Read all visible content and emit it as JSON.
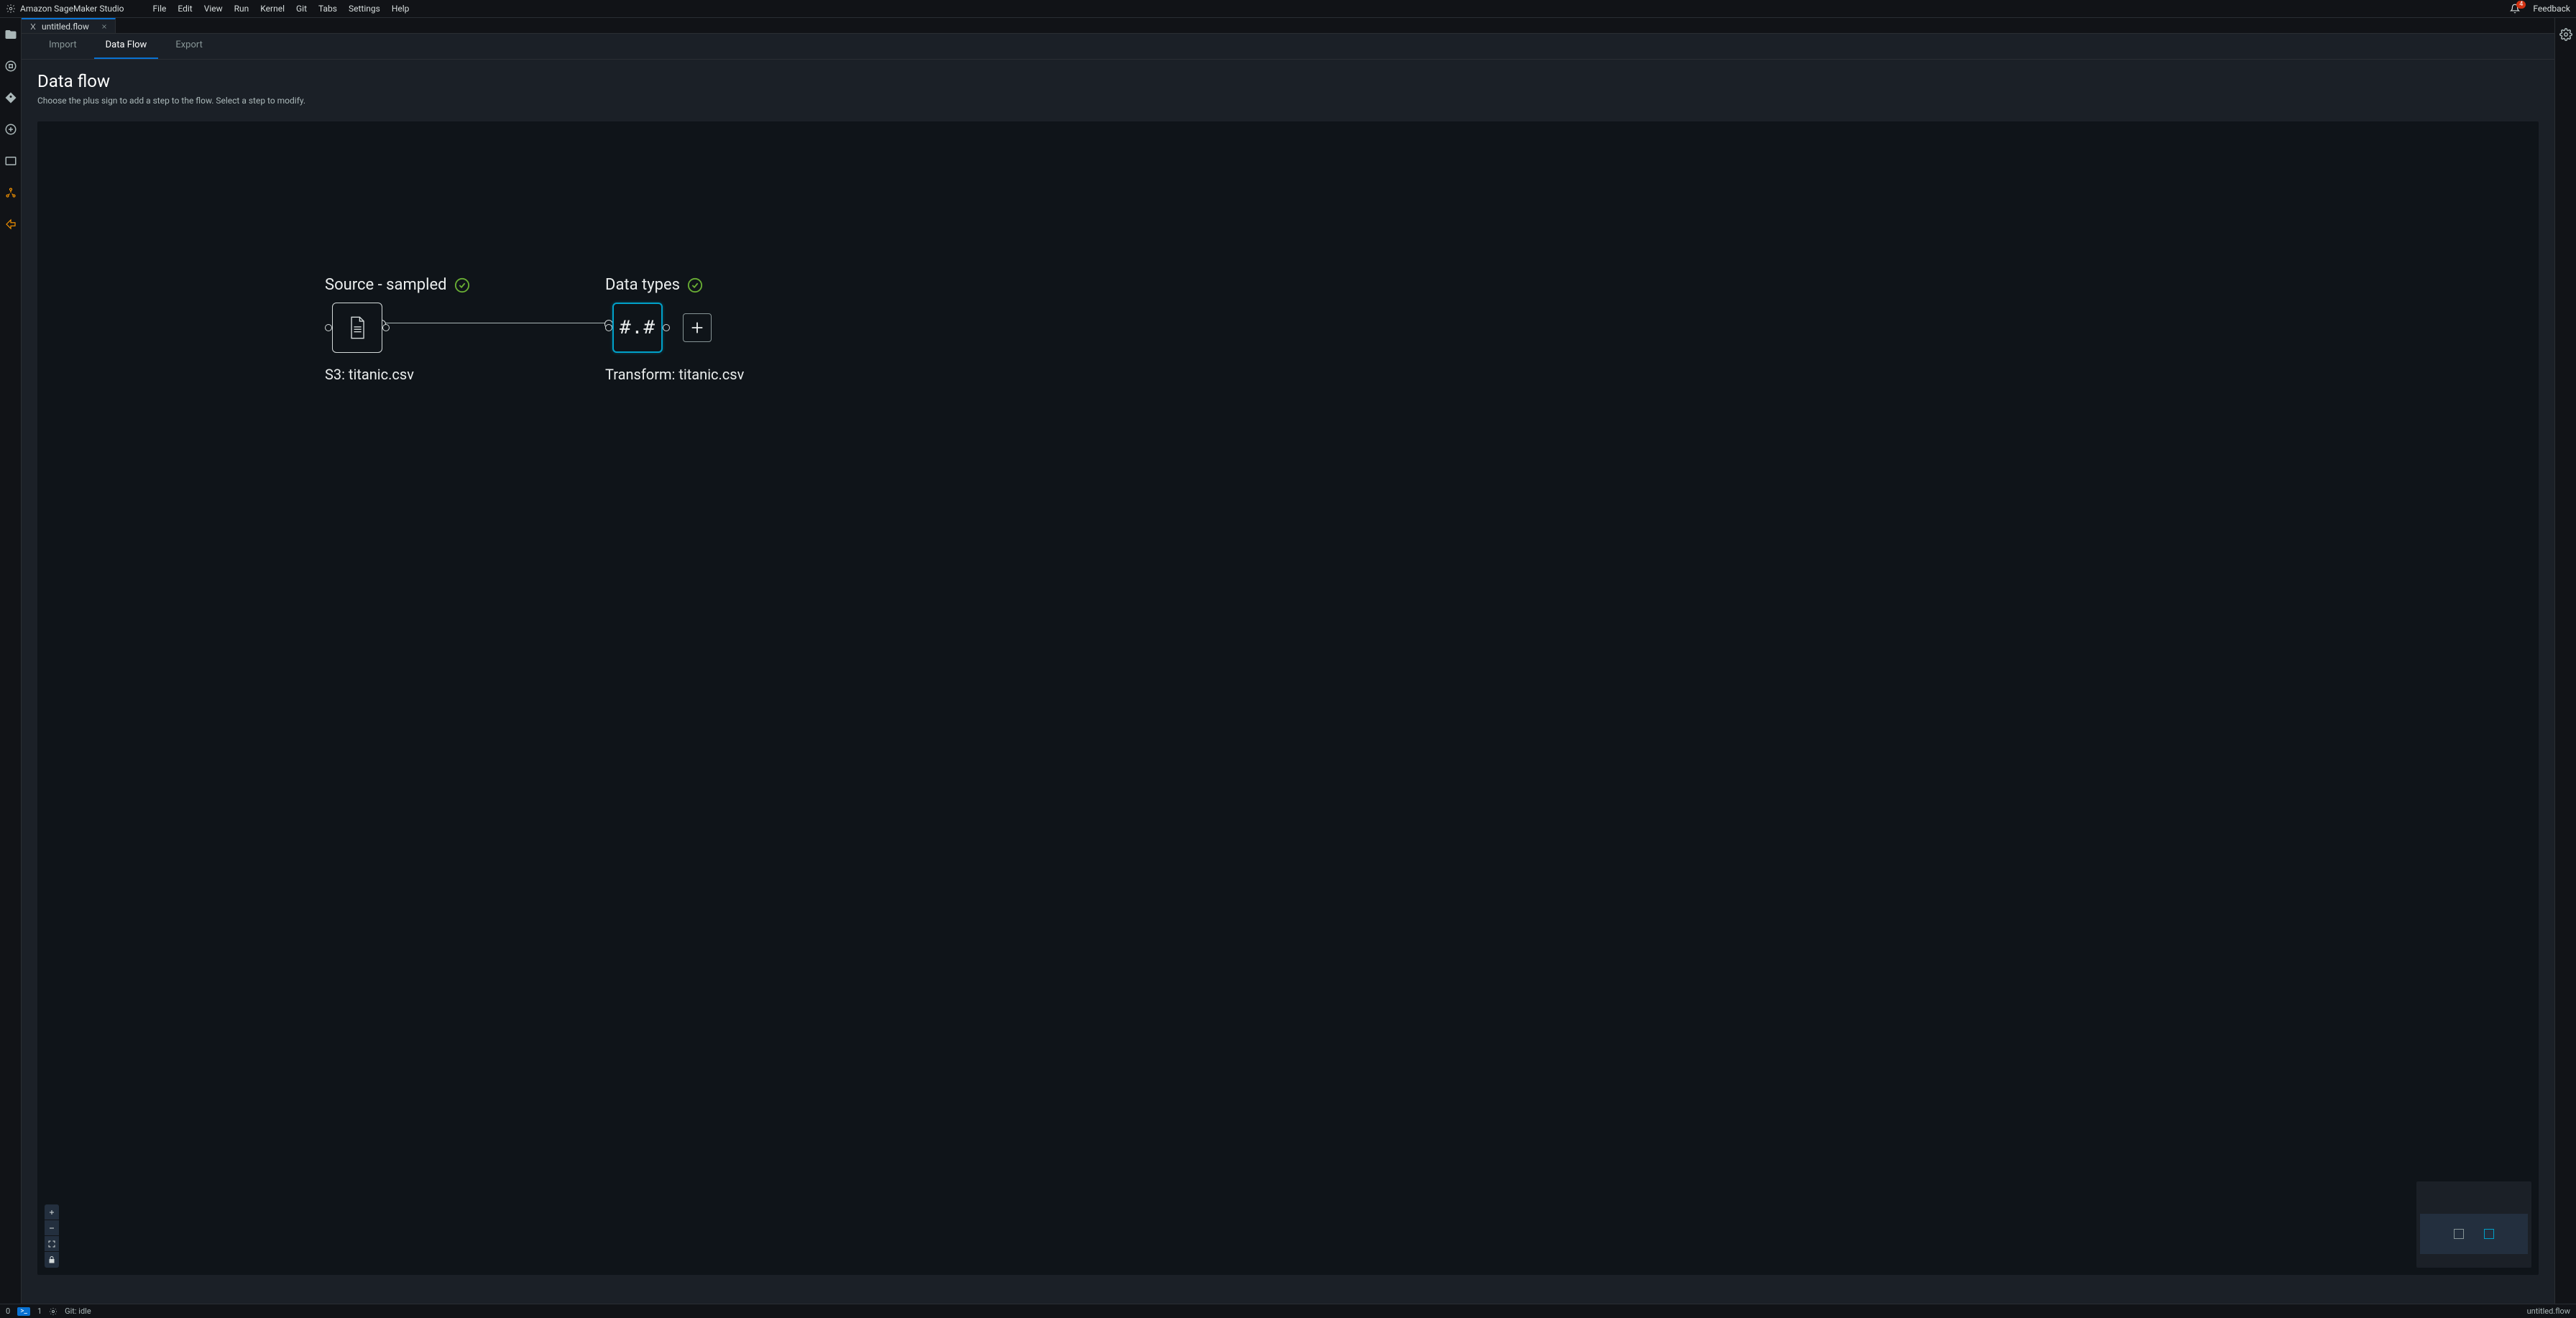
{
  "menubar": {
    "brand": "Amazon SageMaker Studio",
    "menus": [
      "File",
      "Edit",
      "View",
      "Run",
      "Kernel",
      "Git",
      "Tabs",
      "Settings",
      "Help"
    ],
    "notification_count": "4",
    "feedback": "Feedback"
  },
  "doc_tab": {
    "title": "untitled.flow"
  },
  "subtabs": {
    "import": "Import",
    "dataflow": "Data Flow",
    "export": "Export"
  },
  "header": {
    "title": "Data flow",
    "subtitle": "Choose the plus sign to add a step to the flow. Select a step to modify."
  },
  "nodes": {
    "source": {
      "title": "Source - sampled",
      "subtitle": "S3: titanic.csv"
    },
    "types": {
      "title": "Data types",
      "glyph": "#.#",
      "subtitle": "Transform: titanic.csv"
    }
  },
  "statusbar": {
    "left_num": "0",
    "mode": "1",
    "git": "Git: idle",
    "right_file": "untitled.flow"
  }
}
